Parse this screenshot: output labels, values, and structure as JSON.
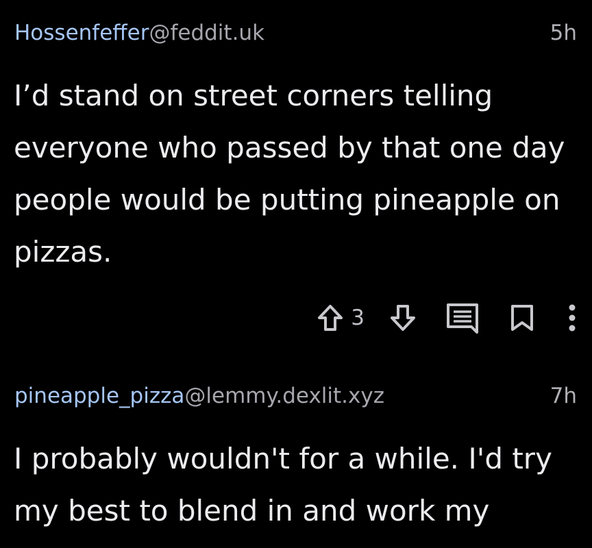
{
  "comments": [
    {
      "author": "Hossenfeffer",
      "instance": "@feddit.uk",
      "time": "5h",
      "text": "I’d stand on street corners telling everyone who passed by that one day people would be putting pineapple on pizzas.",
      "score": "3",
      "icons": [
        "upvote-icon",
        "downvote-icon",
        "reply-icon",
        "bookmark-icon",
        "more-icon"
      ]
    },
    {
      "author": "pineapple_pizza",
      "instance": "@lemmy.dexlit.xyz",
      "time": "7h",
      "text": "I probably wouldn't for a while. I'd try my best to blend in and work my"
    }
  ],
  "colors": {
    "background": "#000000",
    "author": "#a6c6f5",
    "instance": "#a6a6ad",
    "text": "#ececef",
    "icon": "#c8c8cd"
  }
}
